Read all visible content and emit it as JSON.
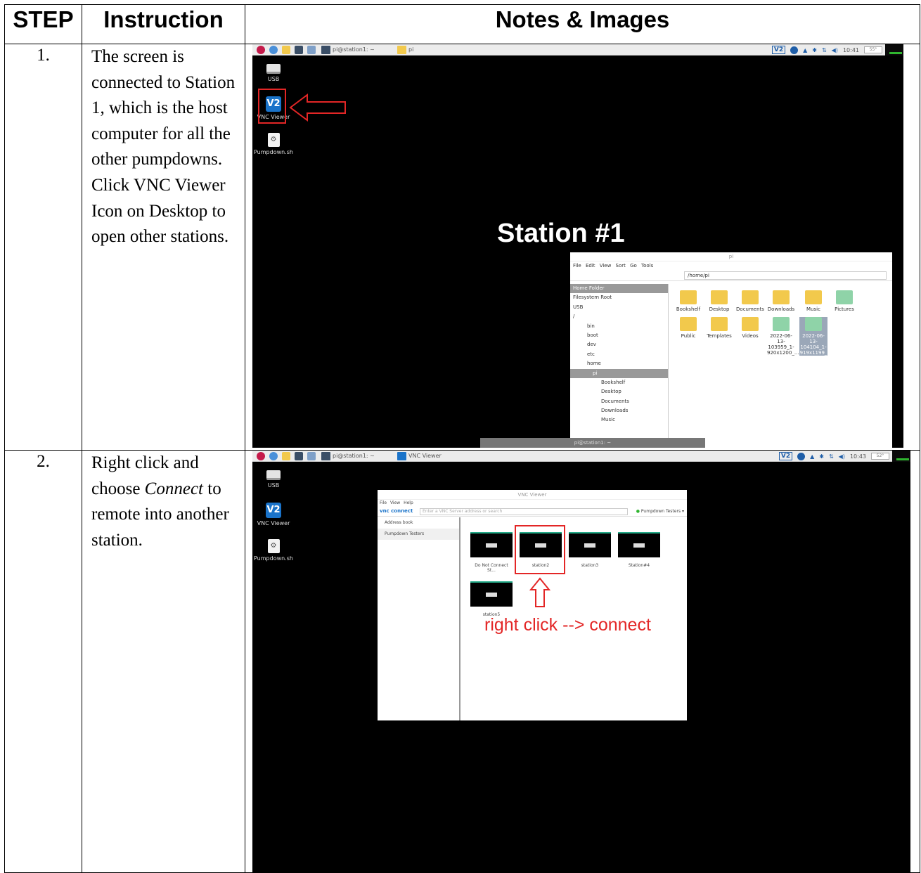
{
  "headers": {
    "step": "STEP",
    "instruction": "Instruction",
    "notes": "Notes & Images"
  },
  "rows": [
    {
      "step": "1.",
      "instruction": "The screen is connected to Station 1, which is the host computer for all the other pumpdowns. Click VNC Viewer Icon on Desktop to open other stations.",
      "shot": {
        "taskbar": {
          "task1": "pi@station1: ~",
          "task2": "pi",
          "time": "10:41",
          "cpu": "55°"
        },
        "desktop_icons": [
          "USB",
          "VNC Viewer",
          "Pumpdown.sh"
        ],
        "overlay_title": "Station #1",
        "file_manager": {
          "title": "pi",
          "menu": "File Edit View Sort Go Tools",
          "path": "/home/pi",
          "sidebar": [
            "Home Folder",
            "Filesystem Root",
            "USB",
            "/",
            "bin",
            "boot",
            "dev",
            "etc",
            "home",
            "pi",
            "Bookshelf",
            "Desktop",
            "Documents",
            "Downloads",
            "Music"
          ],
          "items": [
            "Bookshelf",
            "Desktop",
            "Documents",
            "Downloads",
            "Music",
            "Pictures",
            "Public",
            "Templates",
            "Videos",
            "2022-06-13-103959_1-920x1200_...",
            "2022-06-13-104104_1-919x1199_"
          ]
        },
        "terminal_title": "pi@station1: ~"
      }
    },
    {
      "step": "2.",
      "instruction_pre": "Right click and choose ",
      "instruction_em": "Connect",
      "instruction_post": " to remote into another station.",
      "shot": {
        "taskbar": {
          "task1": "pi@station1: ~",
          "task2": "VNC Viewer",
          "time": "10:43",
          "cpu": "52°"
        },
        "desktop_icons": [
          "USB",
          "VNC Viewer",
          "Pumpdown.sh"
        ],
        "vnc_window": {
          "title": "VNC Viewer",
          "menu": "File View Help",
          "logo": "vnc connect",
          "search_placeholder": "Enter a VNC Server address or search",
          "team": "Pumpdown Testers",
          "sidebar": [
            "Address book",
            "Pumpdown Testers"
          ],
          "tiles": [
            "Do Not Connect St...",
            "station2",
            "station3",
            "Station#4",
            "station5"
          ]
        },
        "note": "right click --> connect"
      }
    }
  ]
}
